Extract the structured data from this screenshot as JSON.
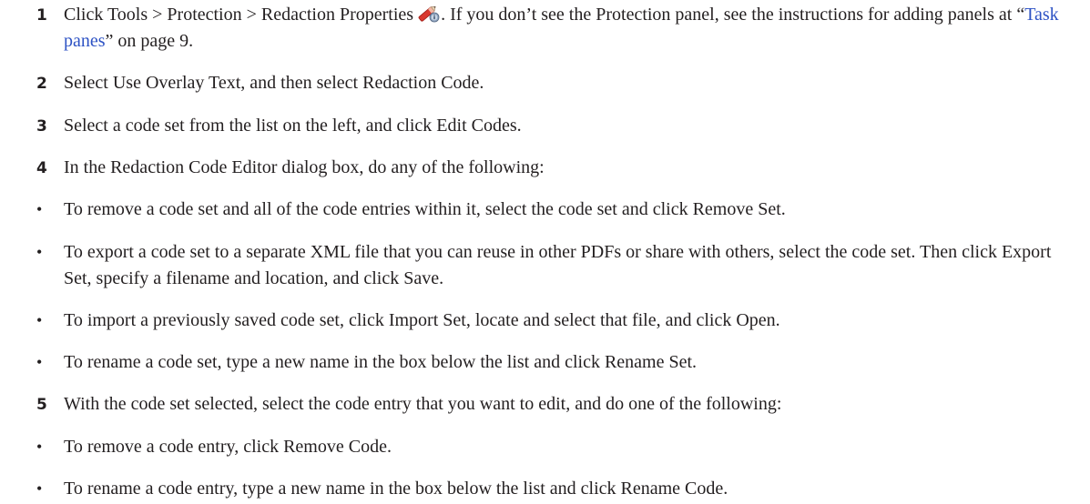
{
  "steps": [
    {
      "number": "1",
      "text_before_icon": "Click Tools > Protection > Redaction Properties",
      "text_after_icon": ". If you don’t see the Protection panel, see the instructions for adding panels at “",
      "link_text": "Task panes",
      "text_after_link": "” on page 9."
    },
    {
      "number": "2",
      "text": "Select Use Overlay Text, and then select Redaction Code."
    },
    {
      "number": "3",
      "text": "Select a code set from the list on the left, and click Edit Codes."
    },
    {
      "number": "4",
      "text": "In the Redaction Code Editor dialog box, do any of the following:"
    },
    {
      "number": "5",
      "text": "With the code set selected, select the code entry that you want to edit, and do one of the following:"
    }
  ],
  "bullets_step4": [
    "To remove a code set and all of the code entries within it, select the code set and click Remove Set.",
    "To export a code set to a separate XML file that you can reuse in other PDFs or share with others, select the code set. Then click Export Set, specify a filename and location, and click Save.",
    "To import a previously saved code set, click Import Set, locate and select that file, and click Open.",
    "To rename a code set, type a new name in the box below the list and click Rename Set."
  ],
  "bullets_step5": [
    "To remove a code entry, click Remove Code.",
    "To rename a code entry, type a new name in the box below the list and click Rename Code."
  ],
  "bullet_glyph": "•",
  "icons": {
    "redaction_properties": "redaction-properties-icon"
  },
  "colors": {
    "text": "#231f20",
    "link": "#2d52c4"
  }
}
